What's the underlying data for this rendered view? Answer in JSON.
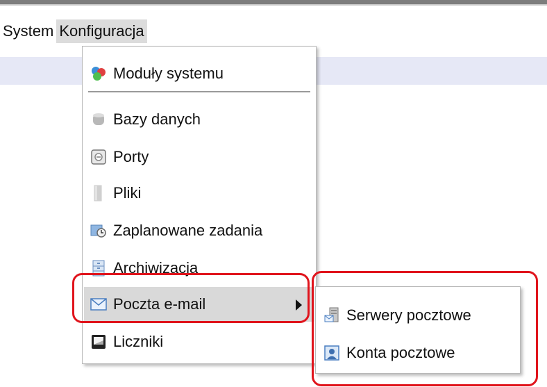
{
  "menubar": {
    "items": [
      {
        "label": "System"
      },
      {
        "label": "Konfiguracja"
      }
    ]
  },
  "menu": {
    "items": [
      {
        "label": "Moduły systemu",
        "icon": "modules-icon"
      },
      {
        "label": "Bazy danych",
        "icon": "database-icon"
      },
      {
        "label": "Porty",
        "icon": "port-icon"
      },
      {
        "label": "Pliki",
        "icon": "files-icon"
      },
      {
        "label": "Zaplanowane zadania",
        "icon": "scheduled-tasks-icon"
      },
      {
        "label": "Archiwizacja",
        "icon": "archive-icon"
      },
      {
        "label": "Poczta e-mail",
        "icon": "mail-icon",
        "has_submenu": true
      },
      {
        "label": "Liczniki",
        "icon": "counter-icon"
      }
    ]
  },
  "submenu": {
    "items": [
      {
        "label": "Serwery pocztowe",
        "icon": "mail-server-icon"
      },
      {
        "label": "Konta pocztowe",
        "icon": "mail-account-icon"
      }
    ]
  },
  "colors": {
    "highlight_box": "#e0141c",
    "active_bg": "#dcdcdc",
    "strip": "#e6e8f6"
  }
}
